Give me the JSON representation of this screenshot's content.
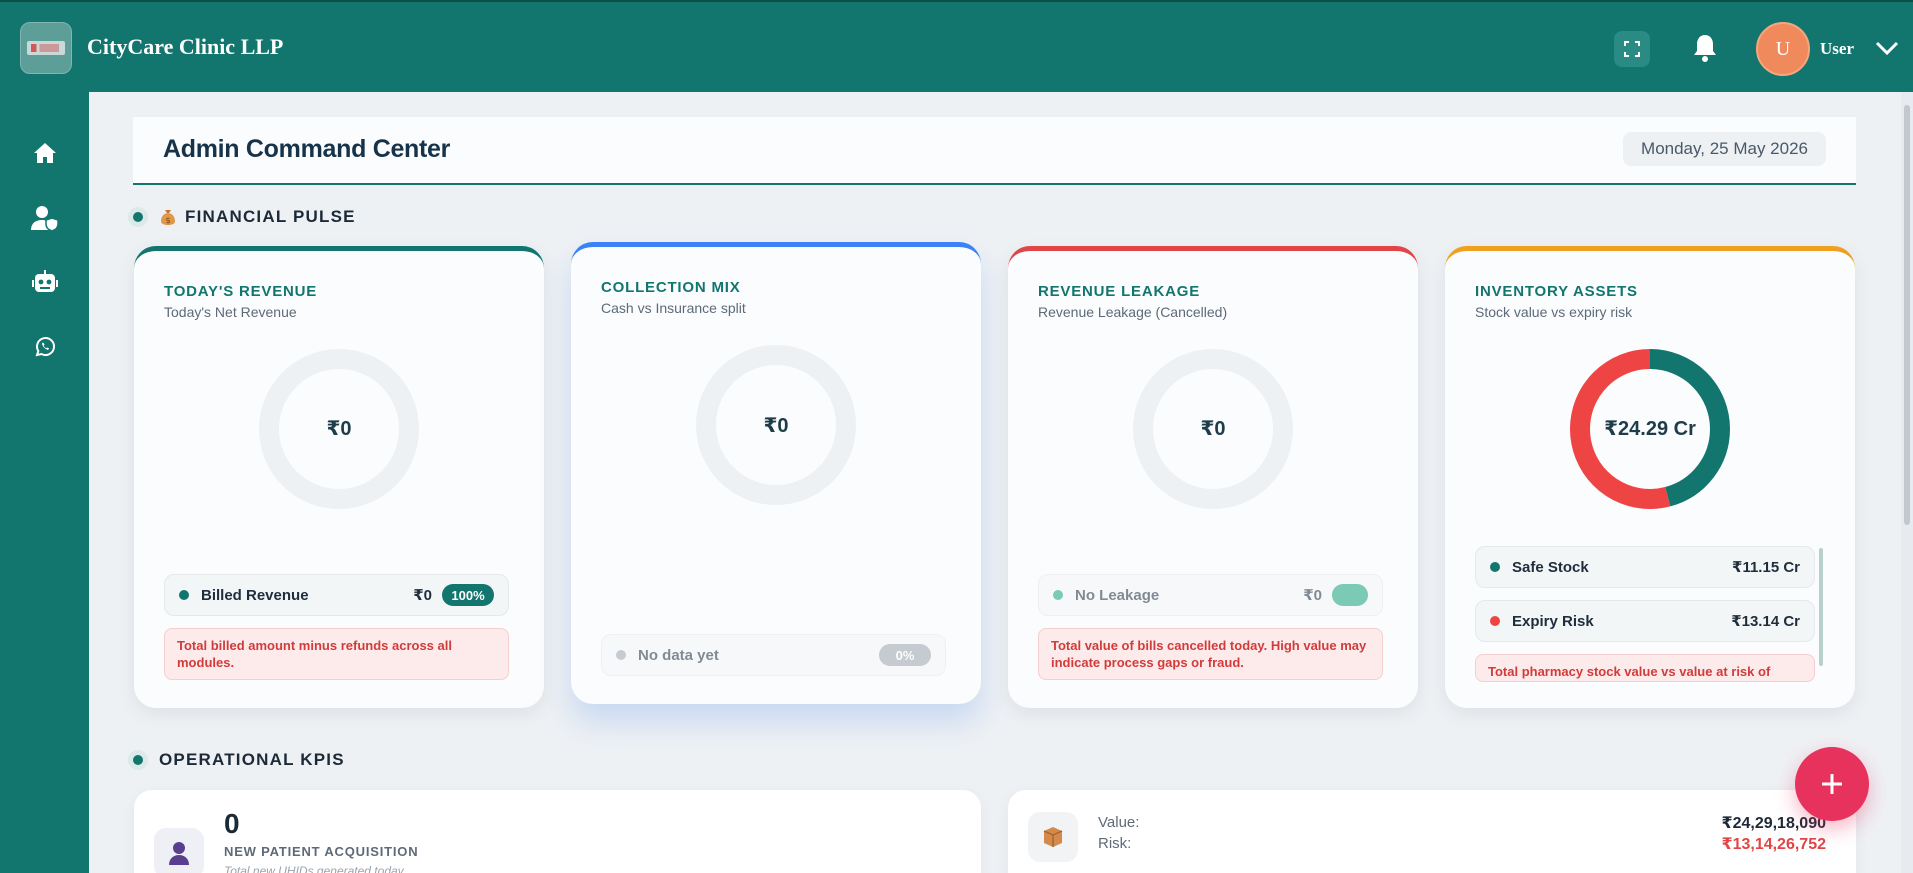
{
  "app": {
    "name": "CityCare Clinic LLP"
  },
  "topbar": {
    "user_initial": "U",
    "user_name": "User"
  },
  "sidebar": {
    "items": [
      {
        "icon": "home-icon"
      },
      {
        "icon": "user-shield-icon"
      },
      {
        "icon": "robot-icon"
      },
      {
        "icon": "whatsapp-icon"
      }
    ]
  },
  "header": {
    "title": "Admin Command Center",
    "date": "Monday, 25 May 2026"
  },
  "financial": {
    "section_label": "FINANCIAL PULSE",
    "cards": [
      {
        "title": "TODAY'S REVENUE",
        "subtitle": "Today's Net Revenue",
        "center_value": "₹0",
        "accent": "#12766f",
        "legend": {
          "label": "Billed Revenue",
          "value": "₹0",
          "pct": "100%"
        },
        "note": "Total billed amount minus refunds across all modules."
      },
      {
        "title": "COLLECTION MIX",
        "subtitle": "Cash vs Insurance split",
        "center_value": "₹0",
        "accent": "#3b82f6",
        "legend": {
          "label": "No data yet",
          "value": "",
          "pct": "0%"
        }
      },
      {
        "title": "REVENUE LEAKAGE",
        "subtitle": "Revenue Leakage (Cancelled)",
        "center_value": "₹0",
        "accent": "#e04646",
        "legend": {
          "label": "No Leakage",
          "value": "₹0",
          "pct": ""
        },
        "note": "Total value of bills cancelled today. High value may indicate process gaps or fraud."
      },
      {
        "title": "INVENTORY ASSETS",
        "subtitle": "Stock value vs expiry risk",
        "center_value": "₹24.29 Cr",
        "accent": "#f0a020",
        "legend": [
          {
            "label": "Safe Stock",
            "value": "₹11.15 Cr",
            "color": "#12766f"
          },
          {
            "label": "Expiry Risk",
            "value": "₹13.14 Cr",
            "color": "#ef4444"
          }
        ],
        "note": "Total pharmacy stock value vs value at risk of"
      }
    ]
  },
  "operational": {
    "section_label": "OPERATIONAL KPIS",
    "new_patients": {
      "value": "0",
      "label": "NEW PATIENT ACQUISITION",
      "footnote": "Total new UHIDs generated today"
    },
    "inventory": {
      "value_label": "Value:",
      "value": "₹24,29,18,090",
      "risk_label": "Risk:",
      "risk": "₹13,14,26,752"
    }
  },
  "chart_data": [
    {
      "type": "pie",
      "title": "TODAY'S REVENUE",
      "center": "₹0",
      "slices": [
        {
          "label": "Billed Revenue",
          "value": 0
        }
      ]
    },
    {
      "type": "pie",
      "title": "COLLECTION MIX",
      "center": "₹0",
      "slices": []
    },
    {
      "type": "pie",
      "title": "REVENUE LEAKAGE",
      "center": "₹0",
      "slices": [
        {
          "label": "No Leakage",
          "value": 0
        }
      ]
    },
    {
      "type": "pie",
      "title": "INVENTORY ASSETS",
      "center": "₹24.29 Cr",
      "unit": "₹ Cr",
      "slices": [
        {
          "label": "Safe Stock",
          "value": 11.15,
          "color": "#12766f"
        },
        {
          "label": "Expiry Risk",
          "value": 13.14,
          "color": "#ef4444"
        }
      ]
    }
  ]
}
